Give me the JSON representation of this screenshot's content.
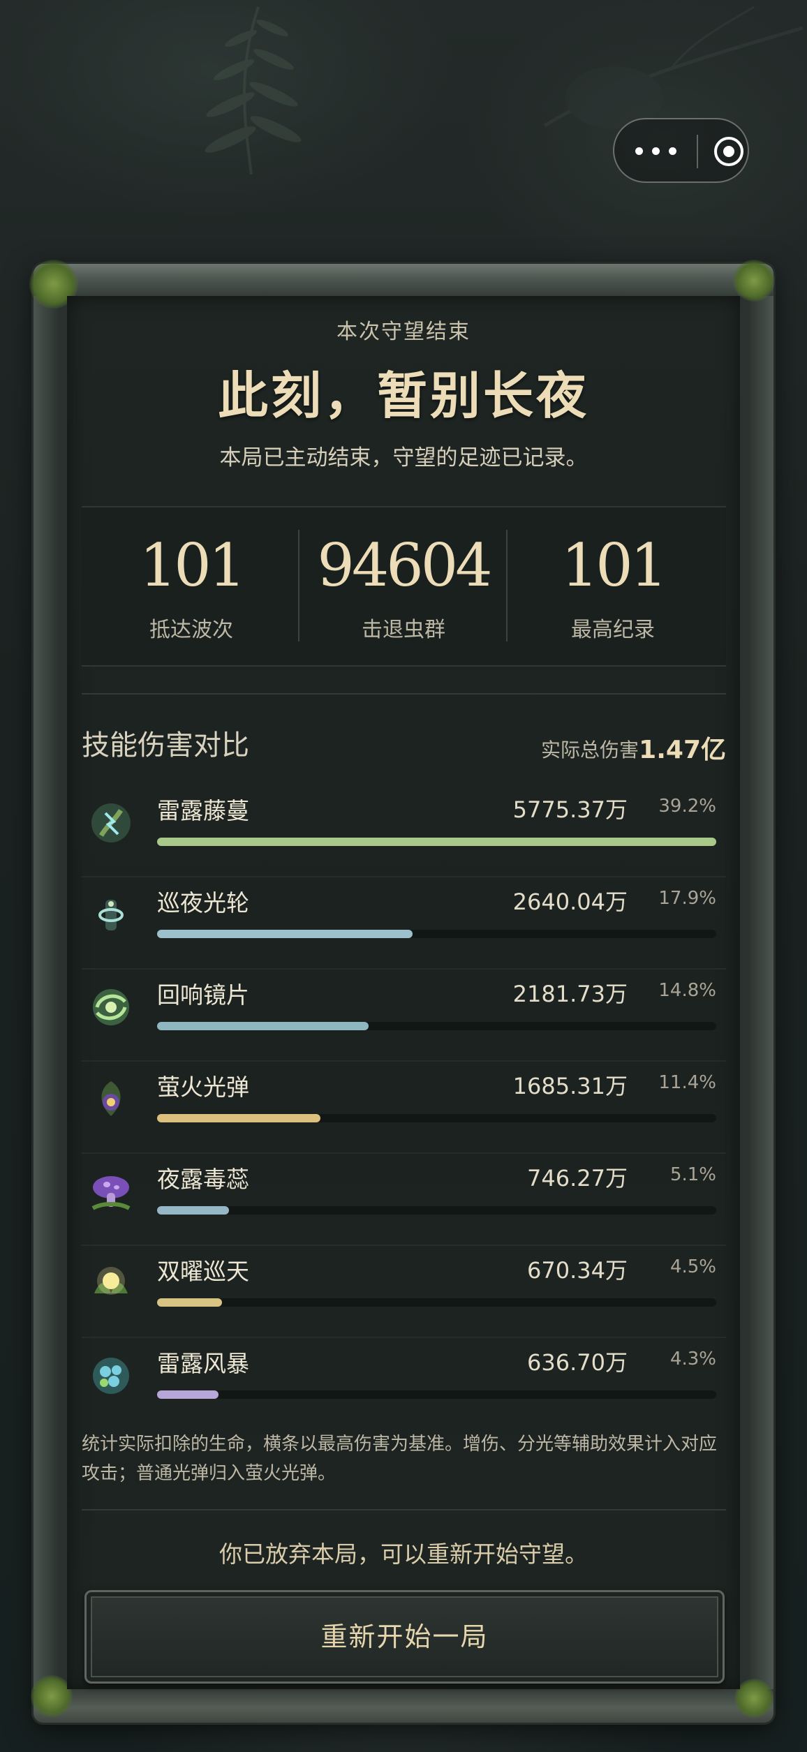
{
  "capsule": {
    "more_icon": "more-dots-icon",
    "close_icon": "target-circle-icon"
  },
  "header": {
    "eyebrow": "本次守望结束",
    "title": "此刻，暂别长夜",
    "subtitle": "本局已主动结束，守望的足迹已记录。"
  },
  "stats": [
    {
      "value": "101",
      "label": "抵达波次"
    },
    {
      "value": "94604",
      "label": "击退虫群"
    },
    {
      "value": "101",
      "label": "最高纪录"
    }
  ],
  "damage": {
    "heading": "技能伤害对比",
    "total_label": "实际总伤害",
    "total_value": "1.47亿",
    "skills": [
      {
        "name": "雷露藤蔓",
        "value": "5775.37万",
        "percent": "39.2%",
        "bar_fraction": 1.0,
        "color": "#a9c98a",
        "icon": "thunder-vine-icon"
      },
      {
        "name": "巡夜光轮",
        "value": "2640.04万",
        "percent": "17.9%",
        "bar_fraction": 0.457,
        "color": "#9cc0cc",
        "icon": "night-halo-icon"
      },
      {
        "name": "回响镜片",
        "value": "2181.73万",
        "percent": "14.8%",
        "bar_fraction": 0.378,
        "color": "#8fb7bf",
        "icon": "echo-lens-icon"
      },
      {
        "name": "萤火光弹",
        "value": "1685.31万",
        "percent": "11.4%",
        "bar_fraction": 0.292,
        "color": "#dcc07e",
        "icon": "firefly-orb-icon"
      },
      {
        "name": "夜露毒蕊",
        "value": "746.27万",
        "percent": "5.1%",
        "bar_fraction": 0.129,
        "color": "#95b7c6",
        "icon": "poison-mushroom-icon"
      },
      {
        "name": "双曜巡天",
        "value": "670.34万",
        "percent": "4.5%",
        "bar_fraction": 0.116,
        "color": "#d8c584",
        "icon": "twin-star-icon"
      },
      {
        "name": "雷露风暴",
        "value": "636.70万",
        "percent": "4.3%",
        "bar_fraction": 0.11,
        "color": "#b7a6d8",
        "icon": "storm-flower-icon"
      }
    ]
  },
  "note": "统计实际扣除的生命，横条以最高伤害为基准。增伤、分光等辅助效果计入对应攻击；普通光弹归入萤火光弹。",
  "abandon_text": "你已放弃本局，可以重新开始守望。",
  "restart_label": "重新开始一局"
}
